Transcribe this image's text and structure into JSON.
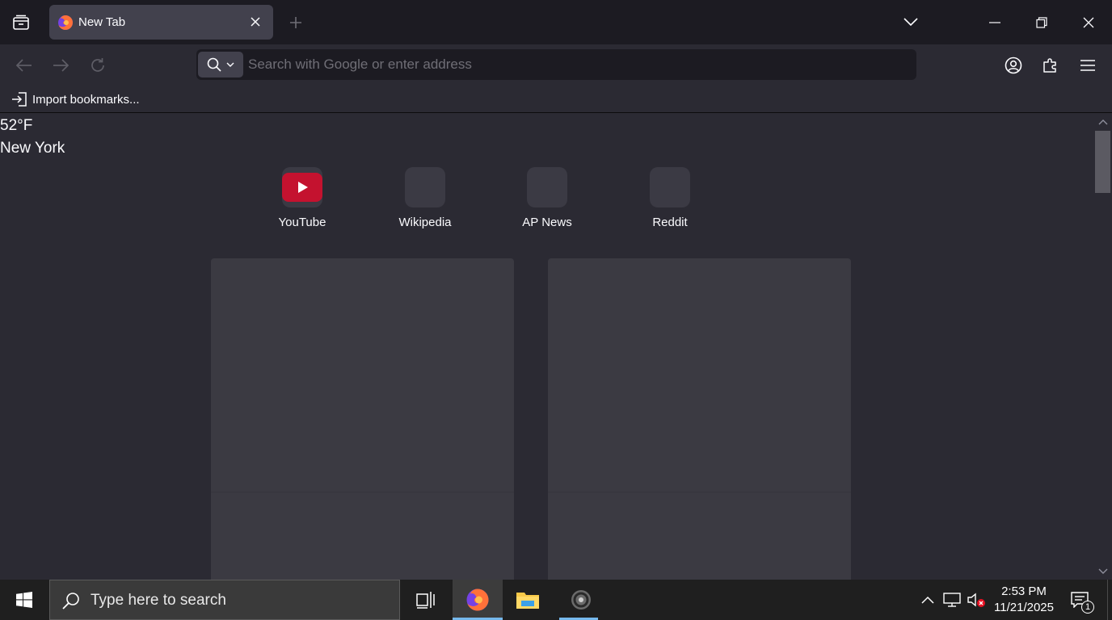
{
  "browser": {
    "tab": {
      "title": "New Tab"
    },
    "urlbar": {
      "placeholder": "Search with Google or enter address",
      "value": ""
    },
    "bookmarks": {
      "import_label": "Import bookmarks..."
    }
  },
  "newtab": {
    "weather": {
      "temperature": "52°F",
      "location": "New York"
    },
    "top_sites": [
      {
        "label": "YouTube",
        "icon": "youtube-icon"
      },
      {
        "label": "Wikipedia",
        "icon": ""
      },
      {
        "label": "AP News",
        "icon": ""
      },
      {
        "label": "Reddit",
        "icon": ""
      }
    ]
  },
  "taskbar": {
    "search_placeholder": "Type here to search",
    "apps": [
      "firefox-icon",
      "file-explorer-icon",
      "app-icon"
    ],
    "clock": {
      "time": "2:53 PM",
      "date": "11/21/2025"
    },
    "notifications_count": "1"
  },
  "colors": {
    "accent": "#76b9ed",
    "youtube_red": "#c4122f",
    "chrome_bg": "#1c1b22",
    "content_bg": "#2b2a33"
  }
}
